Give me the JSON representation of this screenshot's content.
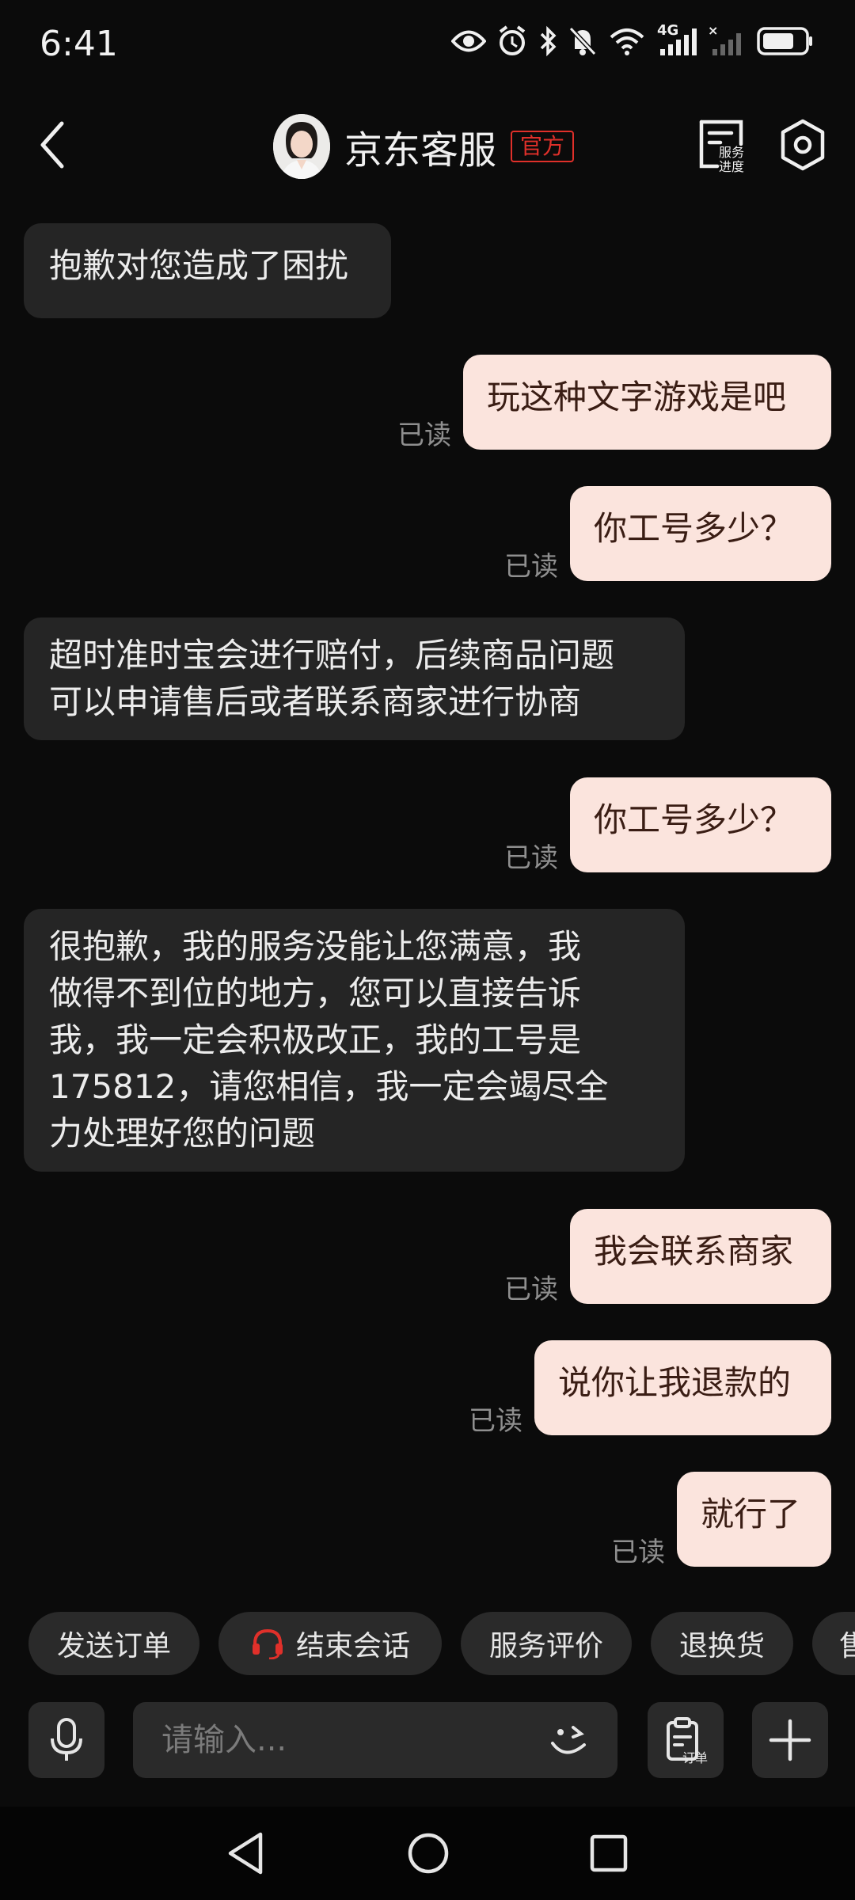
{
  "status": {
    "time": "6:41",
    "network": "4G",
    "icons": [
      "eye-icon",
      "alarm-icon",
      "bluetooth-icon",
      "mute-icon",
      "wifi-icon",
      "signal-icon",
      "no-signal-icon",
      "battery-icon"
    ]
  },
  "header": {
    "title": "京东客服",
    "badge": "官方",
    "service_progress_label_1": "服务",
    "service_progress_label_2": "进度"
  },
  "messages": [
    {
      "side": "in",
      "text": "抱歉对您造成了困扰"
    },
    {
      "side": "out",
      "text": "玩这种文字游戏是吧",
      "status": "已读"
    },
    {
      "side": "out",
      "text": "你工号多少？",
      "status": "已读"
    },
    {
      "side": "in",
      "lines": [
        "超时准时宝会进行赔付，后续商品问题",
        "可以申请售后或者联系商家进行协商"
      ]
    },
    {
      "side": "out",
      "text": "你工号多少？",
      "status": "已读"
    },
    {
      "side": "in",
      "lines": [
        "很抱歉，我的服务没能让您满意，我",
        "做得不到位的地方，您可以直接告诉",
        "我，我一定会积极改正，我的工号是",
        "175812，请您相信，我一定会竭尽全",
        "力处理好您的问题"
      ]
    },
    {
      "side": "out",
      "text": "我会联系商家",
      "status": "已读"
    },
    {
      "side": "out",
      "text": "说你让我退款的",
      "status": "已读"
    },
    {
      "side": "out",
      "text": "就行了",
      "status": "已读"
    }
  ],
  "quick_actions": [
    "发送订单",
    "结束会话",
    "服务评价",
    "退换货",
    "售"
  ],
  "input": {
    "placeholder": "请输入...",
    "order_label": "订单"
  },
  "colors": {
    "background": "#0b0b0b",
    "incoming_bubble": "#252525",
    "outgoing_bubble": "#fbe4dd",
    "badge": "#e0302a",
    "headset_icon": "#e0302a"
  }
}
